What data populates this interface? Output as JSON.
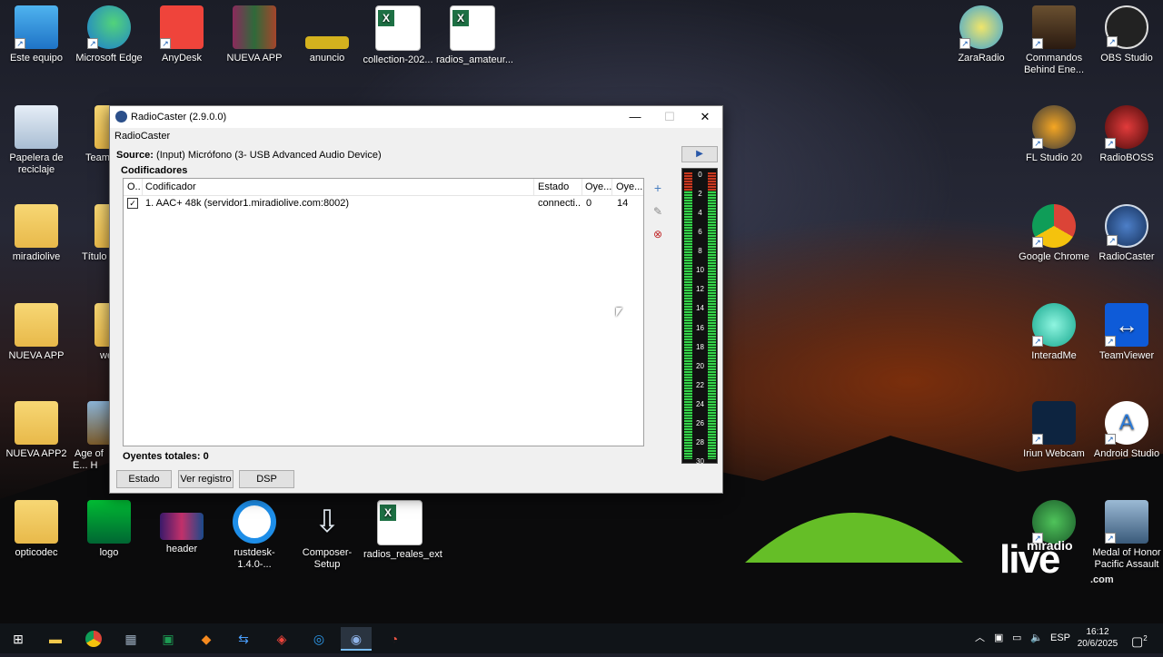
{
  "desktop": {
    "left_icons": [
      {
        "label": "Este equipo",
        "icon": "computer-icon"
      },
      {
        "label": "Microsoft Edge",
        "icon": "edge-icon"
      },
      {
        "label": "AnyDesk",
        "icon": "anydesk-icon"
      },
      {
        "label": "NUEVA APP",
        "icon": "winrar-icon"
      },
      {
        "label": "anuncio",
        "icon": "image-icon"
      },
      {
        "label": "collection-202...",
        "icon": "excel-icon"
      },
      {
        "label": "radios_amateur...",
        "icon": "excel-icon"
      },
      {
        "label": "Papelera de reciclaje",
        "icon": "recycle-bin-icon"
      },
      {
        "label": "Team",
        "icon": "app-icon"
      },
      {
        "label": "miradiolive",
        "icon": "folder-icon"
      },
      {
        "label": "Título",
        "icon": "folder-icon"
      },
      {
        "label": "NUEVA APP",
        "icon": "folder-icon"
      },
      {
        "label": "we",
        "icon": "folder-icon"
      },
      {
        "label": "NUEVA APP2",
        "icon": "folder-icon"
      },
      {
        "label": "Age of E... H",
        "icon": "game-icon"
      },
      {
        "label": "opticodec",
        "icon": "folder-icon"
      },
      {
        "label": "logo",
        "icon": "image-icon"
      },
      {
        "label": "header",
        "icon": "image-icon"
      },
      {
        "label": "rustdesk-1.4.0-...",
        "icon": "rustdesk-icon"
      },
      {
        "label": "Composer-Setup",
        "icon": "installer-icon"
      },
      {
        "label": "radios_reales_ext",
        "icon": "excel-icon"
      }
    ],
    "right_icons": [
      {
        "label": "ZaraRadio",
        "icon": "zararadio-icon"
      },
      {
        "label": "Commandos Behind Ene...",
        "icon": "game-icon"
      },
      {
        "label": "OBS Studio",
        "icon": "obs-icon"
      },
      {
        "label": "FL Studio 20",
        "icon": "fl-studio-icon"
      },
      {
        "label": "RadioBOSS",
        "icon": "radioboss-icon"
      },
      {
        "label": "Google Chrome",
        "icon": "chrome-icon"
      },
      {
        "label": "RadioCaster",
        "icon": "radiocaster-icon"
      },
      {
        "label": "InteradMe",
        "icon": "app-icon"
      },
      {
        "label": "TeamViewer",
        "icon": "teamviewer-icon"
      },
      {
        "label": "Iriun Webcam",
        "icon": "webcam-icon"
      },
      {
        "label": "Android Studio",
        "icon": "android-studio-icon"
      },
      {
        "label": "Medal of Honor Pacific Assault",
        "icon": "game-icon"
      }
    ]
  },
  "window": {
    "title": "RadioCaster (2.9.0.0)",
    "menu_label": "RadioCaster",
    "source_label": "Source:",
    "source_value": "(Input) Micrófono (3- USB Advanced Audio Device)",
    "group_title": "Codificadores",
    "columns": [
      "O..",
      "Codificador",
      "Estado",
      "Oye...",
      "Oye..."
    ],
    "rows": [
      {
        "checked": true,
        "encoder": "1. AAC+ 48k (servidor1.miradiolive.com:8002)",
        "status": "connecti...",
        "listeners": "0",
        "peak": "14"
      }
    ],
    "totals": "Oyentes totales: 0",
    "buttons": {
      "estado": "Estado",
      "registro": "Ver registro",
      "dsp": "DSP"
    },
    "meter_scale": [
      "0",
      "2",
      "4",
      "6",
      "8",
      "10",
      "12",
      "14",
      "16",
      "18",
      "20",
      "22",
      "24",
      "26",
      "28",
      "30"
    ],
    "colors": {
      "meter_green": "#35d24a",
      "meter_red": "#c83a20"
    }
  },
  "taskbar": {
    "items": [
      "windows-start-icon",
      "file-explorer-icon",
      "chrome-icon",
      "calculator-icon",
      "excel-icon",
      "sublime-icon",
      "teamviewer-icon",
      "anydesk-icon",
      "rustdesk-icon",
      "radiocaster-icon",
      "radioboss-icon"
    ],
    "language": "ESP",
    "time": "16:12",
    "date": "20/6/2025",
    "notifications": "2"
  },
  "watermark": {
    "big": "live",
    "small": "miradio",
    "suffix": ".com"
  }
}
